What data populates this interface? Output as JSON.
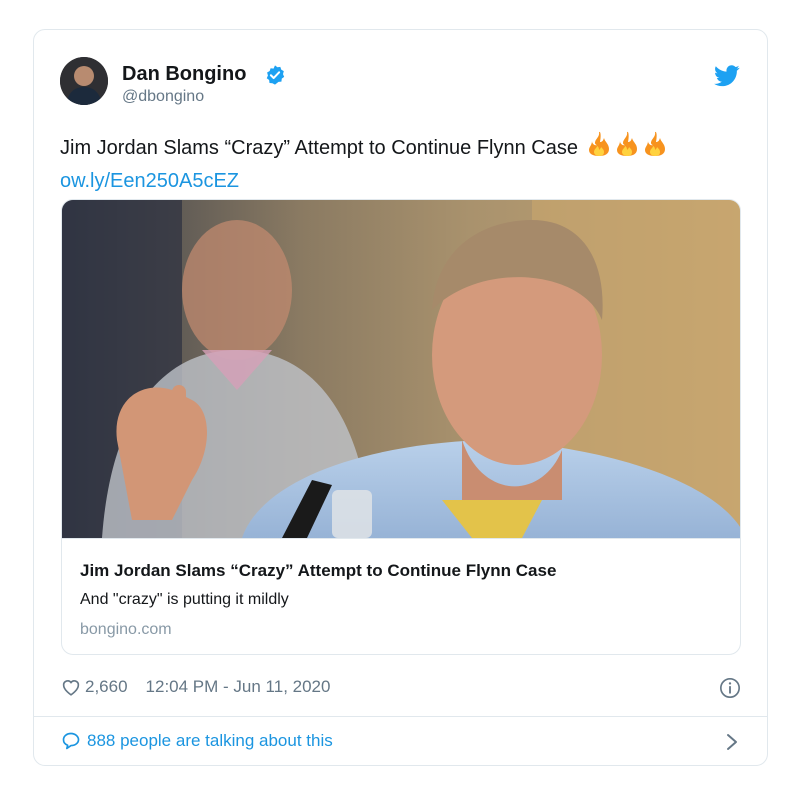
{
  "tweet": {
    "author_name": "Dan Bongino",
    "author_handle": "@dbongino",
    "text": "Jim Jordan Slams “Crazy” Attempt to Continue Flynn Case",
    "emoji_count": 3,
    "link": "ow.ly/Een250A5cEZ",
    "likes": "2,660",
    "timestamp": "12:04 PM - Jun 11, 2020",
    "talking": "888 people are talking about this"
  },
  "card": {
    "title": "Jim Jordan Slams “Crazy” Attempt to Continue Flynn Case",
    "description": "And \"crazy\" is putting it mildly",
    "domain": "bongino.com"
  },
  "icons": {
    "verified": "verified-badge-icon",
    "bird": "twitter-bird-icon",
    "fire": "fire-emoji-icon",
    "heart": "heart-icon",
    "info": "info-icon",
    "comment": "comment-bubble-icon",
    "chevron": "chevron-right-icon"
  },
  "colors": {
    "accent": "#1b95e0",
    "muted": "#657786",
    "border": "#e1e8ed"
  }
}
